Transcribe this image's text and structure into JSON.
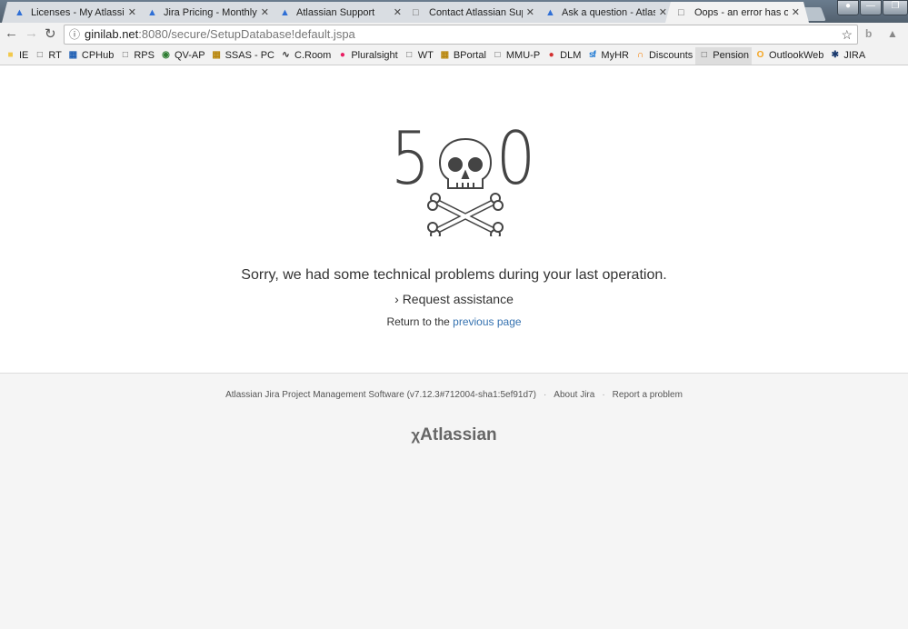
{
  "browser": {
    "tabs": [
      {
        "label": "Licenses - My Atlassian",
        "icon": "atlassian-icon"
      },
      {
        "label": "Jira Pricing - Monthly and Annual",
        "icon": "atlassian-icon"
      },
      {
        "label": "Atlassian Support",
        "icon": "atlassian-icon"
      },
      {
        "label": "Contact Atlassian Support",
        "icon": "page-icon"
      },
      {
        "label": "Ask a question - Atlassian",
        "icon": "atlassian-icon"
      },
      {
        "label": "Oops - an error has occurred",
        "icon": "page-icon",
        "active": true
      }
    ],
    "url_host": "ginilab.net",
    "url_path": ":8080/secure/SetupDatabase!default.jspa",
    "bookmarks": [
      "IE",
      "RT",
      "CPHub",
      "RPS",
      "QV-AP",
      "SSAS - PC",
      "C.Room",
      "Pluralsight",
      "WT",
      "BPortal",
      "MMU-P",
      "DLM",
      "MyHR",
      "Discounts",
      "Pension",
      "OutlookWeb",
      "JIRA"
    ]
  },
  "error": {
    "code_left": "5",
    "code_right": "0",
    "message": "Sorry, we had some technical problems during your last operation.",
    "request_assistance": "Request assistance",
    "return_prefix": "Return to the ",
    "return_link": "previous page"
  },
  "footer": {
    "version": "Atlassian Jira Project Management Software (v7.12.3#712004-sha1:5ef91d7)",
    "about": "About Jira",
    "report": "Report a problem",
    "logo": "Atlassian"
  }
}
